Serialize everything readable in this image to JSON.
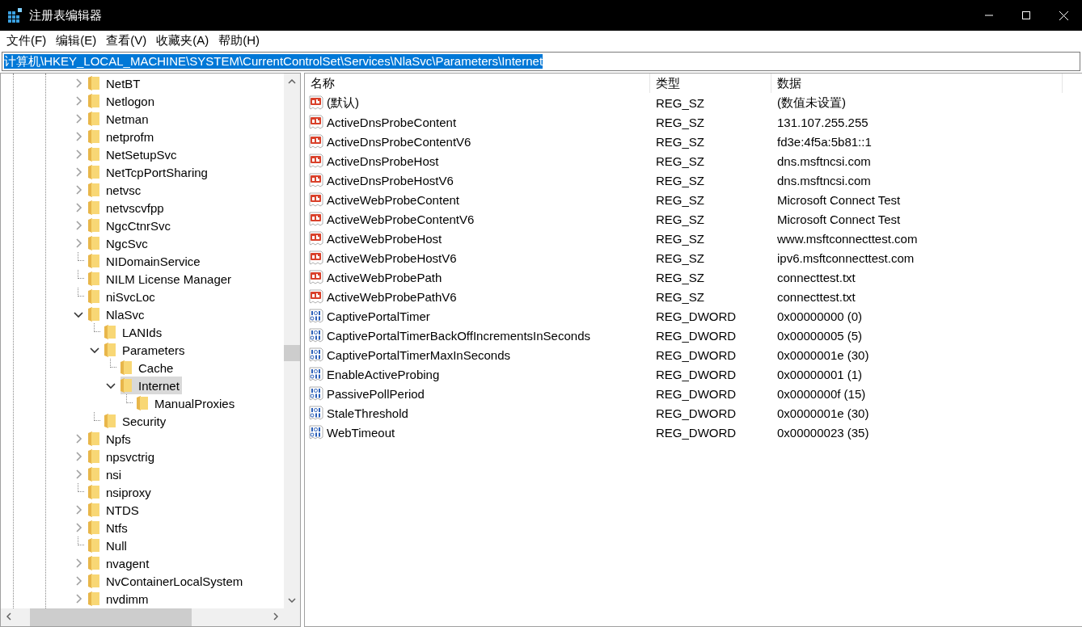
{
  "window": {
    "title": "注册表编辑器"
  },
  "menu": [
    "文件(F)",
    "编辑(E)",
    "查看(V)",
    "收藏夹(A)",
    "帮助(H)"
  ],
  "address": {
    "value": "计算机\\HKEY_LOCAL_MACHINE\\SYSTEM\\CurrentControlSet\\Services\\NlaSvc\\Parameters\\Internet",
    "text_selected": true
  },
  "tree": {
    "items": [
      {
        "label": "NetBT",
        "kind": "branch",
        "expanded": false,
        "selected": false
      },
      {
        "label": "Netlogon",
        "kind": "branch",
        "expanded": false,
        "selected": false
      },
      {
        "label": "Netman",
        "kind": "branch",
        "expanded": false,
        "selected": false
      },
      {
        "label": "netprofm",
        "kind": "branch",
        "expanded": false,
        "selected": false
      },
      {
        "label": "NetSetupSvc",
        "kind": "branch",
        "expanded": false,
        "selected": false
      },
      {
        "label": "NetTcpPortSharing",
        "kind": "branch",
        "expanded": false,
        "selected": false
      },
      {
        "label": "netvsc",
        "kind": "branch",
        "expanded": false,
        "selected": false
      },
      {
        "label": "netvscvfpp",
        "kind": "branch",
        "expanded": false,
        "selected": false
      },
      {
        "label": "NgcCtnrSvc",
        "kind": "branch",
        "expanded": false,
        "selected": false
      },
      {
        "label": "NgcSvc",
        "kind": "branch",
        "expanded": false,
        "selected": false
      },
      {
        "label": "NIDomainService",
        "kind": "leaf",
        "selected": false
      },
      {
        "label": "NILM License Manager",
        "kind": "leaf",
        "selected": false
      },
      {
        "label": "niSvcLoc",
        "kind": "leaf",
        "selected": false
      },
      {
        "label": "NlaSvc",
        "kind": "branch",
        "expanded": true,
        "selected": false,
        "children": [
          {
            "label": "LANIds",
            "kind": "leaf",
            "selected": false
          },
          {
            "label": "Parameters",
            "kind": "branch",
            "expanded": true,
            "selected": false,
            "children": [
              {
                "label": "Cache",
                "kind": "leaf",
                "selected": false
              },
              {
                "label": "Internet",
                "kind": "branch",
                "expanded": true,
                "selected": true,
                "children": [
                  {
                    "label": "ManualProxies",
                    "kind": "leaf",
                    "selected": false
                  }
                ]
              }
            ]
          },
          {
            "label": "Security",
            "kind": "leaf",
            "selected": false
          }
        ]
      },
      {
        "label": "Npfs",
        "kind": "branch",
        "expanded": false,
        "selected": false
      },
      {
        "label": "npsvctrig",
        "kind": "branch",
        "expanded": false,
        "selected": false
      },
      {
        "label": "nsi",
        "kind": "branch",
        "expanded": false,
        "selected": false
      },
      {
        "label": "nsiproxy",
        "kind": "leaf",
        "selected": false
      },
      {
        "label": "NTDS",
        "kind": "branch",
        "expanded": false,
        "selected": false
      },
      {
        "label": "Ntfs",
        "kind": "branch",
        "expanded": false,
        "selected": false
      },
      {
        "label": "Null",
        "kind": "leaf",
        "selected": false
      },
      {
        "label": "nvagent",
        "kind": "branch",
        "expanded": false,
        "selected": false
      },
      {
        "label": "NvContainerLocalSystem",
        "kind": "branch",
        "expanded": false,
        "selected": false
      },
      {
        "label": "nvdimm",
        "kind": "branch",
        "expanded": false,
        "selected": false
      }
    ]
  },
  "values": {
    "columns": [
      "名称",
      "类型",
      "数据"
    ],
    "rows": [
      {
        "name": "(默认)",
        "type": "REG_SZ",
        "data": "(数值未设置)",
        "kind": "string"
      },
      {
        "name": "ActiveDnsProbeContent",
        "type": "REG_SZ",
        "data": "131.107.255.255",
        "kind": "string"
      },
      {
        "name": "ActiveDnsProbeContentV6",
        "type": "REG_SZ",
        "data": "fd3e:4f5a:5b81::1",
        "kind": "string"
      },
      {
        "name": "ActiveDnsProbeHost",
        "type": "REG_SZ",
        "data": "dns.msftncsi.com",
        "kind": "string"
      },
      {
        "name": "ActiveDnsProbeHostV6",
        "type": "REG_SZ",
        "data": "dns.msftncsi.com",
        "kind": "string"
      },
      {
        "name": "ActiveWebProbeContent",
        "type": "REG_SZ",
        "data": "Microsoft Connect Test",
        "kind": "string"
      },
      {
        "name": "ActiveWebProbeContentV6",
        "type": "REG_SZ",
        "data": "Microsoft Connect Test",
        "kind": "string"
      },
      {
        "name": "ActiveWebProbeHost",
        "type": "REG_SZ",
        "data": "www.msftconnecttest.com",
        "kind": "string"
      },
      {
        "name": "ActiveWebProbeHostV6",
        "type": "REG_SZ",
        "data": "ipv6.msftconnecttest.com",
        "kind": "string"
      },
      {
        "name": "ActiveWebProbePath",
        "type": "REG_SZ",
        "data": "connecttest.txt",
        "kind": "string"
      },
      {
        "name": "ActiveWebProbePathV6",
        "type": "REG_SZ",
        "data": "connecttest.txt",
        "kind": "string"
      },
      {
        "name": "CaptivePortalTimer",
        "type": "REG_DWORD",
        "data": "0x00000000 (0)",
        "kind": "dword"
      },
      {
        "name": "CaptivePortalTimerBackOffIncrementsInSeconds",
        "type": "REG_DWORD",
        "data": "0x00000005 (5)",
        "kind": "dword"
      },
      {
        "name": "CaptivePortalTimerMaxInSeconds",
        "type": "REG_DWORD",
        "data": "0x0000001e (30)",
        "kind": "dword"
      },
      {
        "name": "EnableActiveProbing",
        "type": "REG_DWORD",
        "data": "0x00000001 (1)",
        "kind": "dword"
      },
      {
        "name": "PassivePollPeriod",
        "type": "REG_DWORD",
        "data": "0x0000000f (15)",
        "kind": "dword"
      },
      {
        "name": "StaleThreshold",
        "type": "REG_DWORD",
        "data": "0x0000001e (30)",
        "kind": "dword"
      },
      {
        "name": "WebTimeout",
        "type": "REG_DWORD",
        "data": "0x00000023 (35)",
        "kind": "dword"
      }
    ]
  }
}
